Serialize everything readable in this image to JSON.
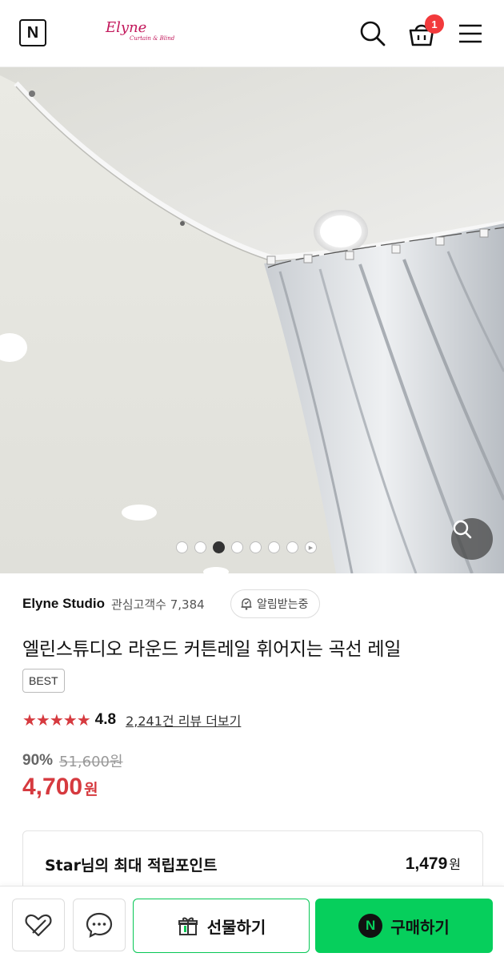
{
  "header": {
    "n_logo": "N",
    "brand_logo_main": "Elyne",
    "brand_logo_sub": "Curtain & Blind",
    "cart_count": "1",
    "icons": [
      "search-icon",
      "cart-icon",
      "menu-icon"
    ]
  },
  "gallery": {
    "image_count": 8,
    "active_index": 3
  },
  "store": {
    "name": "Elyne Studio",
    "followers": "관심고객수 7,384",
    "alarm_label": "알림받는중"
  },
  "product": {
    "title": "엘린스튜디오 라운드 커튼레일 휘어지는 곡선 레일",
    "badge": "BEST",
    "stars": "★★★★★",
    "rating": "4.8",
    "reviews_link": "2,241건 리뷰 더보기",
    "discount": "90%",
    "original_price": "51,600원",
    "sale_price": "4,700",
    "sale_unit": "원"
  },
  "points": {
    "label": "Star님의 최대 적립포인트",
    "value": "1,479",
    "unit": "원"
  },
  "bottom_bar": {
    "gift_label": "선물하기",
    "buy_label": "구매하기",
    "buy_icon_letter": "N"
  },
  "colors": {
    "accent_red": "#d63a3f",
    "naver_green": "#06cf5c",
    "badge_red": "#f23a3c"
  }
}
